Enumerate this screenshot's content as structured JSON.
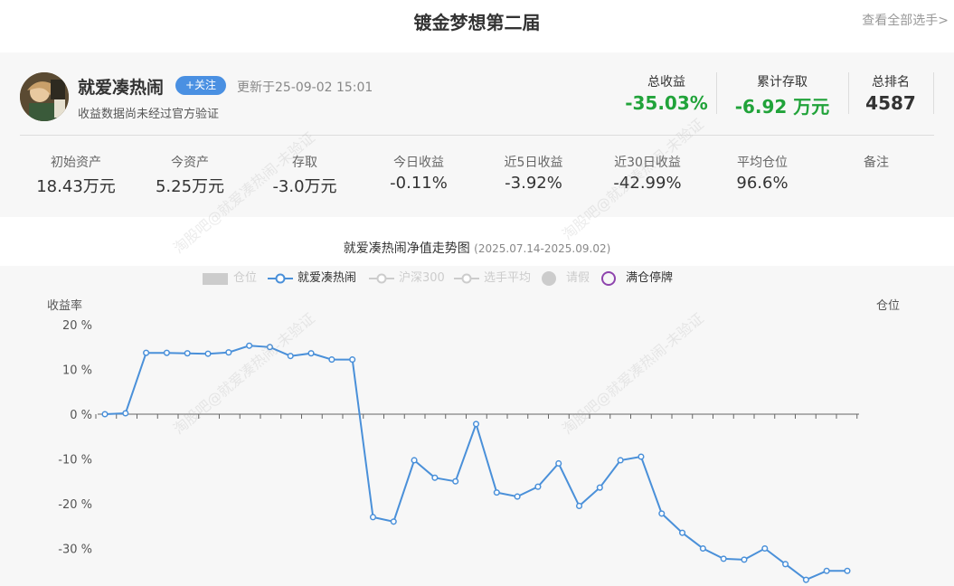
{
  "header": {
    "title": "镀金梦想第二届",
    "view_all": "查看全部选手>"
  },
  "profile": {
    "name": "就爱凑热闹",
    "follow_label": "+关注",
    "updated": "更新于25-09-02 15:01",
    "note": "收益数据尚未经过官方验证"
  },
  "top_stats": [
    {
      "label": "总收益",
      "value": "-35.03%",
      "tone": "green"
    },
    {
      "label": "累计存取",
      "value": "-6.92 万元",
      "tone": "green"
    },
    {
      "label": "总排名",
      "value": "4587",
      "tone": "dark"
    }
  ],
  "bottom_stats": [
    {
      "label": "初始资产",
      "value": "18.43万元",
      "tone": "dark"
    },
    {
      "label": "今资产",
      "value": "5.25万元",
      "tone": "dark"
    },
    {
      "label": "存取",
      "value": "-3.0万元",
      "tone": "green"
    },
    {
      "label": "今日收益",
      "value": "-0.11%",
      "tone": "green"
    },
    {
      "label": "近5日收益",
      "value": "-3.92%",
      "tone": "green"
    },
    {
      "label": "近30日收益",
      "value": "-42.99%",
      "tone": "green"
    },
    {
      "label": "平均仓位",
      "value": "96.6%",
      "tone": "red"
    },
    {
      "label": "备注",
      "value": "",
      "tone": "dark"
    }
  ],
  "chart_title": "就爱凑热闹净值走势图",
  "chart_subtitle": "(2025.07.14-2025.09.02)",
  "legend": {
    "position": "pos-label",
    "name": "就爱凑热闹",
    "hs300": "沪深300",
    "avg": "选手平均",
    "leave": "请假",
    "full": "满仓停牌"
  },
  "watermark": "淘股吧@就爱凑热闹-未验证",
  "colors": {
    "green": "#21a33a",
    "red": "#d0021b",
    "line": "#4a90d9",
    "follow": "#4a90e2",
    "full_marker": "#8e44ad"
  },
  "chart_data": {
    "type": "line",
    "title": "就爱凑热闹净值走势图",
    "subtitle": "(2025.07.14-2025.09.02)",
    "ylabel": "收益率",
    "y2label": "仓位",
    "yticks": [
      "20 %",
      "10 %",
      "0 %",
      "-10 %",
      "-20 %",
      "-30 %"
    ],
    "ylim": [
      -38,
      20
    ],
    "grid": false,
    "legend_position": "top",
    "series": [
      {
        "name": "就爱凑热闹",
        "values": [
          0,
          0.2,
          13.7,
          13.7,
          13.6,
          13.5,
          13.8,
          15.3,
          15.0,
          13.0,
          13.6,
          12.2,
          12.2,
          -23.0,
          -24.0,
          -10.3,
          -14.2,
          -15.0,
          -2.2,
          -17.5,
          -18.4,
          -16.2,
          -11.0,
          -20.5,
          -16.4,
          -10.3,
          -9.5,
          -22.2,
          -26.5,
          -30.0,
          -32.3,
          -32.5,
          -30.0,
          -33.5,
          -37.0,
          -35.0,
          -35.0
        ]
      }
    ]
  }
}
